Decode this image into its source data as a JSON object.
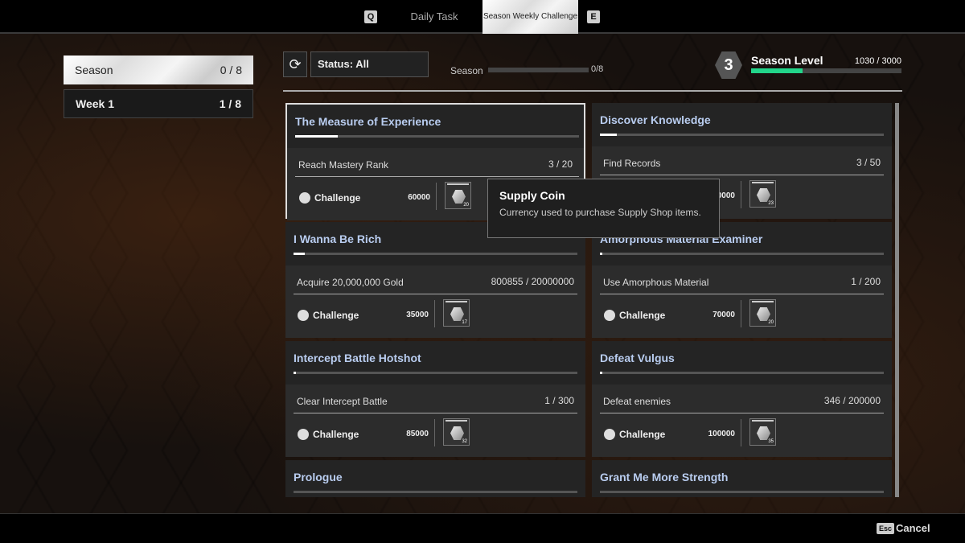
{
  "tabs": {
    "prev_key": "Q",
    "next_key": "E",
    "items": [
      {
        "label": "Daily Task",
        "active": false
      },
      {
        "label": "Season Weekly Challenge",
        "active": true
      }
    ]
  },
  "sidebar": {
    "items": [
      {
        "label": "Season",
        "value": "0 / 8",
        "active": true
      },
      {
        "label": "Week 1",
        "value": "1 / 8",
        "active": false
      }
    ]
  },
  "filter": {
    "refresh_icon": "refresh-icon",
    "status": "Status: All"
  },
  "season_progress": {
    "label": "Season",
    "value": "0/8",
    "fraction": 0
  },
  "season_level": {
    "level": "3",
    "label": "Season Level",
    "value": "1030 / 3000",
    "fraction": 0.343,
    "bar_color": "#22d58a"
  },
  "cards": [
    {
      "title": "The Measure of Experience",
      "progress": 0.15,
      "objective": "Reach Mastery Rank",
      "value": "3 / 20",
      "challenge": "Challenge",
      "points": "60000",
      "reward_count": "20",
      "selected": true
    },
    {
      "title": "Discover Knowledge",
      "progress": 0.06,
      "objective": "Find Records",
      "value": "3 / 50",
      "challenge": "Challenge",
      "points": "70000",
      "reward_count": "23",
      "selected": false
    },
    {
      "title": "I Wanna Be Rich",
      "progress": 0.04,
      "objective": "Acquire 20,000,000 Gold",
      "value": "800855 / 20000000",
      "challenge": "Challenge",
      "points": "35000",
      "reward_count": "17",
      "selected": false
    },
    {
      "title": "Amorphous Material Examiner",
      "progress": 0.005,
      "objective": "Use Amorphous Material",
      "value": "1 / 200",
      "challenge": "Challenge",
      "points": "70000",
      "reward_count": "20",
      "selected": false
    },
    {
      "title": "Intercept Battle Hotshot",
      "progress": 0.005,
      "objective": "Clear Intercept Battle",
      "value": "1 / 300",
      "challenge": "Challenge",
      "points": "85000",
      "reward_count": "32",
      "selected": false
    },
    {
      "title": "Defeat Vulgus",
      "progress": 0.002,
      "objective": "Defeat enemies",
      "value": "346 / 200000",
      "challenge": "Challenge",
      "points": "100000",
      "reward_count": "35",
      "selected": false
    },
    {
      "title": "Prologue",
      "progress": 0,
      "objective": "",
      "value": "",
      "challenge": "",
      "points": "",
      "reward_count": "",
      "selected": false
    },
    {
      "title": "Grant Me More Strength",
      "progress": 0,
      "objective": "",
      "value": "",
      "challenge": "",
      "points": "",
      "reward_count": "",
      "selected": false
    }
  ],
  "tooltip": {
    "title": "Supply Coin",
    "description": "Currency used to purchase Supply Shop items."
  },
  "footer": {
    "esc_key": "Esc",
    "cancel": "Cancel"
  }
}
